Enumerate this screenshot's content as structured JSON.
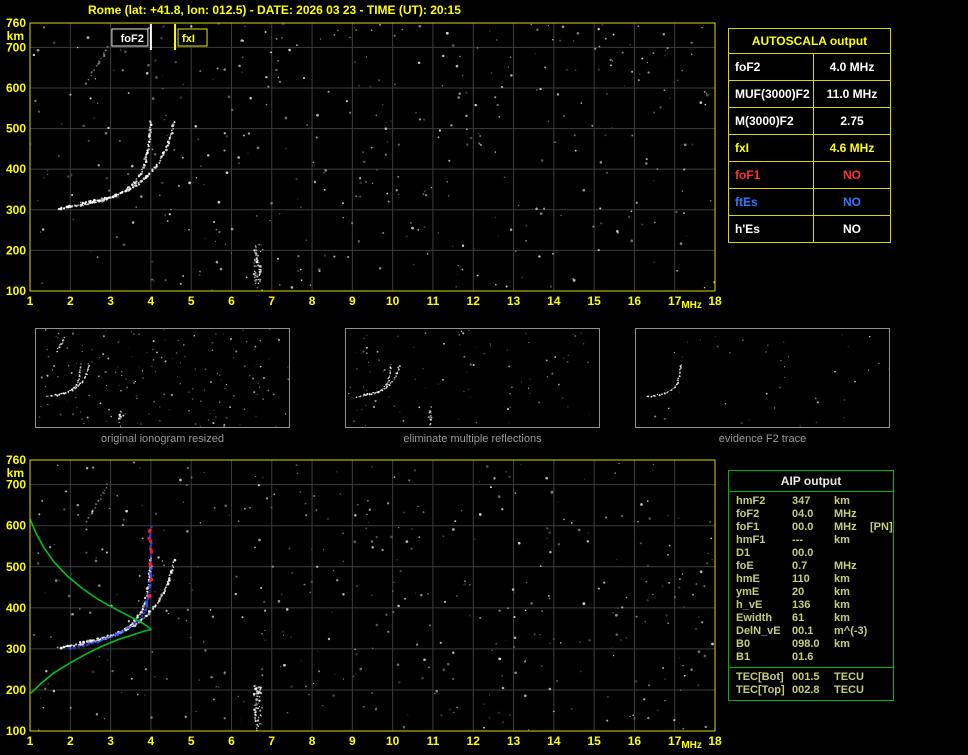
{
  "header": {
    "title": "Rome (lat: +41.8, lon: 012.5) - DATE: 2026 03 23 - TIME (UT): 20:15"
  },
  "colors": {
    "background": "#000000",
    "axis_text": "#ffff00",
    "grid": "#3c3c3c",
    "chart_border": "#d8d800",
    "echo_white": "#ffffff",
    "thumb_border": "#8f8f8f",
    "caption_text": "#9a9a9a",
    "aip_border": "#00b400",
    "aip_text": "#c6cc7c",
    "profile_green": "#00c020",
    "restored_blue": "#3548ff",
    "critical_red": "#ff2020"
  },
  "ionogram_axes": {
    "x_ticks": [
      1,
      2,
      3,
      4,
      5,
      6,
      7,
      8,
      9,
      10,
      11,
      12,
      13,
      14,
      15,
      16,
      17,
      18
    ],
    "x_unit": "MHz",
    "y_ticks": [
      760,
      700,
      600,
      500,
      400,
      300,
      200,
      100
    ],
    "y_unit": "km",
    "x_range": [
      1,
      18
    ],
    "y_range": [
      100,
      760
    ]
  },
  "top_chart": {
    "annotations": [
      {
        "label": "foF2",
        "freq": 4.0,
        "color": "#ffffff",
        "side": "left",
        "boxed": true
      },
      {
        "label": "fxI",
        "freq": 4.6,
        "color": "#ffff00",
        "side": "right",
        "boxed": true
      }
    ],
    "o_trace": [
      [
        1.7,
        303
      ],
      [
        2.0,
        307
      ],
      [
        2.3,
        312
      ],
      [
        2.6,
        318
      ],
      [
        2.9,
        326
      ],
      [
        3.15,
        336
      ],
      [
        3.4,
        350
      ],
      [
        3.6,
        367
      ],
      [
        3.75,
        388
      ],
      [
        3.85,
        412
      ],
      [
        3.92,
        440
      ],
      [
        3.96,
        468
      ],
      [
        3.99,
        498
      ],
      [
        4.0,
        520
      ]
    ],
    "x_trace": [
      [
        2.25,
        316
      ],
      [
        2.55,
        321
      ],
      [
        2.85,
        328
      ],
      [
        3.15,
        337
      ],
      [
        3.45,
        349
      ],
      [
        3.7,
        364
      ],
      [
        3.9,
        382
      ],
      [
        4.1,
        404
      ],
      [
        4.28,
        430
      ],
      [
        4.42,
        458
      ],
      [
        4.52,
        488
      ],
      [
        4.58,
        515
      ]
    ],
    "second_hop": [
      [
        2.4,
        612
      ],
      [
        2.55,
        638
      ],
      [
        2.7,
        660
      ],
      [
        2.82,
        680
      ],
      [
        2.92,
        700
      ]
    ],
    "streak_freq": 6.65,
    "noise_count": 420,
    "seed": 12345
  },
  "bottom_chart": {
    "o_trace": [
      [
        1.7,
        303
      ],
      [
        2.0,
        307
      ],
      [
        2.3,
        312
      ],
      [
        2.6,
        318
      ],
      [
        2.9,
        326
      ],
      [
        3.15,
        336
      ],
      [
        3.4,
        350
      ],
      [
        3.6,
        367
      ],
      [
        3.75,
        388
      ],
      [
        3.85,
        412
      ],
      [
        3.92,
        440
      ],
      [
        3.96,
        468
      ],
      [
        3.99,
        498
      ],
      [
        4.0,
        520
      ]
    ],
    "x_trace": [
      [
        2.25,
        316
      ],
      [
        2.55,
        321
      ],
      [
        2.85,
        328
      ],
      [
        3.15,
        337
      ],
      [
        3.45,
        349
      ],
      [
        3.7,
        364
      ],
      [
        3.9,
        382
      ],
      [
        4.1,
        404
      ],
      [
        4.28,
        430
      ],
      [
        4.42,
        458
      ],
      [
        4.52,
        488
      ],
      [
        4.58,
        515
      ]
    ],
    "second_hop": [
      [
        2.4,
        612
      ],
      [
        2.55,
        638
      ],
      [
        2.7,
        660
      ],
      [
        2.82,
        680
      ],
      [
        2.92,
        700
      ]
    ],
    "streak_freq": 6.65,
    "noise_count": 430,
    "seed": 777,
    "profile": [
      [
        1.02,
        192
      ],
      [
        1.3,
        218
      ],
      [
        1.6,
        242
      ],
      [
        2.0,
        266
      ],
      [
        2.4,
        288
      ],
      [
        2.8,
        307
      ],
      [
        3.2,
        323
      ],
      [
        3.55,
        334
      ],
      [
        3.8,
        342
      ],
      [
        3.95,
        346
      ],
      [
        4.0,
        347
      ],
      [
        3.93,
        354
      ],
      [
        3.78,
        363
      ],
      [
        3.5,
        378
      ],
      [
        3.1,
        398
      ],
      [
        2.7,
        420
      ],
      [
        2.3,
        447
      ],
      [
        1.92,
        478
      ],
      [
        1.6,
        511
      ],
      [
        1.35,
        546
      ],
      [
        1.15,
        582
      ],
      [
        1.0,
        616
      ],
      [
        0.9,
        652
      ],
      [
        0.84,
        678
      ]
    ],
    "restored_trace": [
      [
        2.0,
        300
      ],
      [
        2.4,
        310
      ],
      [
        2.8,
        322
      ],
      [
        3.15,
        336
      ],
      [
        3.45,
        352
      ],
      [
        3.7,
        370
      ],
      [
        3.85,
        392
      ],
      [
        3.93,
        420
      ],
      [
        3.97,
        450
      ],
      [
        3.99,
        480
      ],
      [
        4.0,
        510
      ],
      [
        4.0,
        545
      ],
      [
        4.0,
        575
      ],
      [
        4.0,
        595
      ]
    ],
    "critical_marks": [
      [
        3.97,
        430
      ],
      [
        3.99,
        470
      ],
      [
        4.0,
        505
      ],
      [
        4.01,
        540
      ],
      [
        3.98,
        565
      ],
      [
        4.0,
        588
      ]
    ]
  },
  "thumbnails": [
    {
      "caption": "original ionogram resized",
      "noise_count": 170,
      "seed": 101,
      "show": [
        "o",
        "x",
        "hop"
      ],
      "streak": true
    },
    {
      "caption": "eliminate multiple reflections",
      "noise_count": 90,
      "seed": 202,
      "show": [
        "o",
        "x"
      ],
      "streak": true
    },
    {
      "caption": "evidence F2 trace",
      "noise_count": 40,
      "seed": 303,
      "show": [
        "o"
      ],
      "streak": false
    }
  ],
  "autoscala_table": {
    "title": "AUTOSCALA output",
    "rows": [
      {
        "label": "foF2",
        "value": "4.0 MHz",
        "color": "#ffffff"
      },
      {
        "label": "MUF(3000)F2",
        "value": "11.0 MHz",
        "color": "#ffffff"
      },
      {
        "label": "M(3000)F2",
        "value": "2.75",
        "color": "#ffffff"
      },
      {
        "label": "fxI",
        "value": "4.6 MHz",
        "color": "#ffff00"
      },
      {
        "label": "foF1",
        "value": "NO",
        "color": "#ff3232"
      },
      {
        "label": "ftEs",
        "value": "NO",
        "color": "#3377ff"
      },
      {
        "label": "h'Es",
        "value": "NO",
        "color": "#ffffff"
      }
    ]
  },
  "aip_table": {
    "title": "AIP output",
    "rows": [
      {
        "name": "hmF2",
        "value": "347",
        "unit": "km",
        "extra": ""
      },
      {
        "name": "foF2",
        "value": "04.0",
        "unit": "MHz",
        "extra": ""
      },
      {
        "name": "foF1",
        "value": "00.0",
        "unit": "MHz",
        "extra": "[PN]"
      },
      {
        "name": "hmF1",
        "value": "---",
        "unit": "km",
        "extra": ""
      },
      {
        "name": "D1",
        "value": "00.0",
        "unit": "",
        "extra": ""
      },
      {
        "name": "foE",
        "value": "0.7",
        "unit": "MHz",
        "extra": ""
      },
      {
        "name": "hmE",
        "value": "110",
        "unit": "km",
        "extra": ""
      },
      {
        "name": "ymE",
        "value": "20",
        "unit": "km",
        "extra": ""
      },
      {
        "name": "h_vE",
        "value": "136",
        "unit": "km",
        "extra": ""
      },
      {
        "name": "Ewidth",
        "value": "61",
        "unit": "km",
        "extra": ""
      },
      {
        "name": "DelN_vE",
        "value": "00.1",
        "unit": "m^(-3)",
        "extra": ""
      },
      {
        "name": "B0",
        "value": "098.0",
        "unit": "km",
        "extra": ""
      },
      {
        "name": "B1",
        "value": "01.6",
        "unit": "",
        "extra": ""
      }
    ],
    "tec_rows": [
      {
        "name": "TEC[Bot]",
        "value": "001.5",
        "unit": "TECU"
      },
      {
        "name": "TEC[Top]",
        "value": "002.8",
        "unit": "TECU"
      }
    ]
  }
}
